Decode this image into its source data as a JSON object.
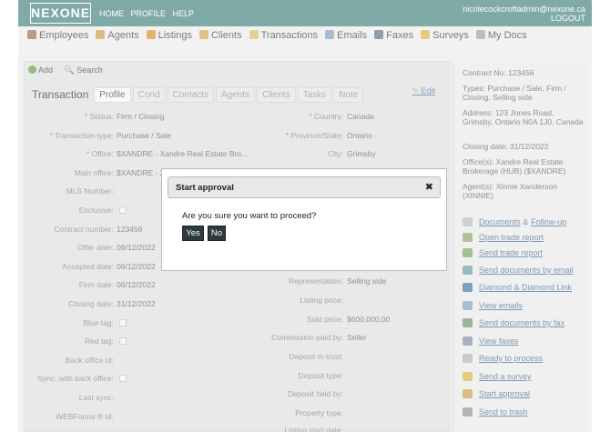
{
  "header": {
    "logo": "NEXONE",
    "nav": [
      "HOME",
      "PROFILE",
      "HELP"
    ],
    "user_email": "nicolecockcroftadmin@nexone.ca",
    "logout": "LOGOUT"
  },
  "mainnav": [
    {
      "label": "Employees",
      "icon": "employees-icon",
      "color": "#8a6a4a"
    },
    {
      "label": "Agents",
      "icon": "agents-icon",
      "color": "#c89a3a"
    },
    {
      "label": "Listings",
      "icon": "listings-icon",
      "color": "#d28a2a"
    },
    {
      "label": "Clients",
      "icon": "clients-icon",
      "color": "#d2a23a"
    },
    {
      "label": "Transactions",
      "icon": "transactions-icon",
      "color": "#d8b85a"
    },
    {
      "label": "Emails",
      "icon": "emails-icon",
      "color": "#7a9ab8"
    },
    {
      "label": "Faxes",
      "icon": "faxes-icon",
      "color": "#5a6a7a"
    },
    {
      "label": "Surveys",
      "icon": "surveys-icon",
      "color": "#d8b040"
    },
    {
      "label": "My Docs",
      "icon": "mydocs-icon",
      "color": "#9a9a9a"
    }
  ],
  "toolbar": {
    "add": "Add",
    "search": "Search"
  },
  "tabs": {
    "title": "Transaction",
    "items": [
      "Profile",
      "Cond",
      "Contacts",
      "Agents",
      "Clients",
      "Tasks",
      "Note"
    ],
    "active": "Profile",
    "edit": "Edit"
  },
  "left_fields": [
    {
      "label": "* Status:",
      "value": "Firm / Closing"
    },
    {
      "label": "* Transaction type:",
      "value": "Purchase / Sale"
    },
    {
      "label": "* Office:",
      "value": "$XANDRE - Xandre Real Estate Bro..."
    },
    {
      "label": "Main office:",
      "value": "$XANDRE - X"
    },
    {
      "label": "MLS Number:",
      "value": ""
    },
    {
      "label": "Exclusive:",
      "value": ""
    },
    {
      "label": "Contract number:",
      "value": "123456"
    },
    {
      "label": "Offer date:",
      "value": "06/12/2022"
    },
    {
      "label": "Accepted date:",
      "value": "06/12/2022"
    },
    {
      "label": "Firm date:",
      "value": "06/12/2022"
    },
    {
      "label": "Closing date:",
      "value": "31/12/2022"
    },
    {
      "label": "Blue tag:",
      "value": ""
    },
    {
      "label": "Red tag:",
      "value": ""
    },
    {
      "label": "Back office Id:",
      "value": ""
    },
    {
      "label": "Sync. with back office:",
      "value": ""
    },
    {
      "label": "Last sync:",
      "value": ""
    },
    {
      "label": "WEBForms ® Id:",
      "value": ""
    }
  ],
  "right_fields": [
    {
      "label": "* Country:",
      "value": "Canada"
    },
    {
      "label": "* Province/State:",
      "value": "Ontario"
    },
    {
      "label": "City:",
      "value": "Grimsby"
    },
    {
      "label": "Representation:",
      "value": "Selling side"
    },
    {
      "label": "Listing price:",
      "value": ""
    },
    {
      "label": "Sold price:",
      "value": "$600,000.00"
    },
    {
      "label": "Commission paid by:",
      "value": "Seller"
    },
    {
      "label": "Deposit in-trust:",
      "value": ""
    },
    {
      "label": "Deposit type:",
      "value": ""
    },
    {
      "label": "Deposit held by:",
      "value": ""
    },
    {
      "label": "Property type:",
      "value": ""
    },
    {
      "label": "Listing start date:",
      "value": ""
    }
  ],
  "side": {
    "contract": "Contract No:  123456",
    "types": "Types:  Purchase / Sale, Firm / Closing, Selling side",
    "address": "Address:  123 Jones Road, Grimsby, Ontario N0A 1J0, Canada",
    "closing": "Closing date:  31/12/2022",
    "offices": "Office(s):  Xandre Real Estate Brokerage (HUB) ($XANDRE)",
    "agents": "Agent(s):  Xinnie Xanderson (XINNIE)",
    "actions": [
      {
        "label": "Documents",
        "extra": "Follow-up",
        "icon": "documents-icon",
        "color": "#b0b8c0"
      },
      {
        "label": "Open trade report",
        "icon": "trade-report-icon",
        "color": "#8aa060"
      },
      {
        "label": "Send trade report",
        "icon": "send-trade-report-icon",
        "color": "#6aa050"
      },
      {
        "label": "Send documents by email",
        "icon": "email-documents-icon",
        "color": "#5a9aa0"
      },
      {
        "label": "Diamond & Diamond Link",
        "icon": "link-icon",
        "color": "#3a6fa0"
      },
      {
        "label": "View emails",
        "icon": "view-emails-icon",
        "color": "#7a9ab8"
      },
      {
        "label": "Send documents by fax",
        "icon": "fax-documents-icon",
        "color": "#6a8a6a"
      },
      {
        "label": "View faxes",
        "icon": "view-faxes-icon",
        "color": "#7a8a9a"
      },
      {
        "label": "Ready to process",
        "icon": "ready-icon",
        "color": "#b0b0b0"
      },
      {
        "label": "Send a survey",
        "icon": "survey-icon",
        "color": "#d8b040"
      },
      {
        "label": "Start approval",
        "icon": "approval-icon",
        "color": "#c09a40"
      },
      {
        "label": "Send to trash",
        "icon": "trash-icon",
        "color": "#8a8a8a"
      }
    ],
    "and": "&"
  },
  "modal": {
    "title": "Start approval",
    "close": "✖",
    "message": "Are you sure you want to proceed?",
    "yes": "Yes",
    "no": "No"
  }
}
